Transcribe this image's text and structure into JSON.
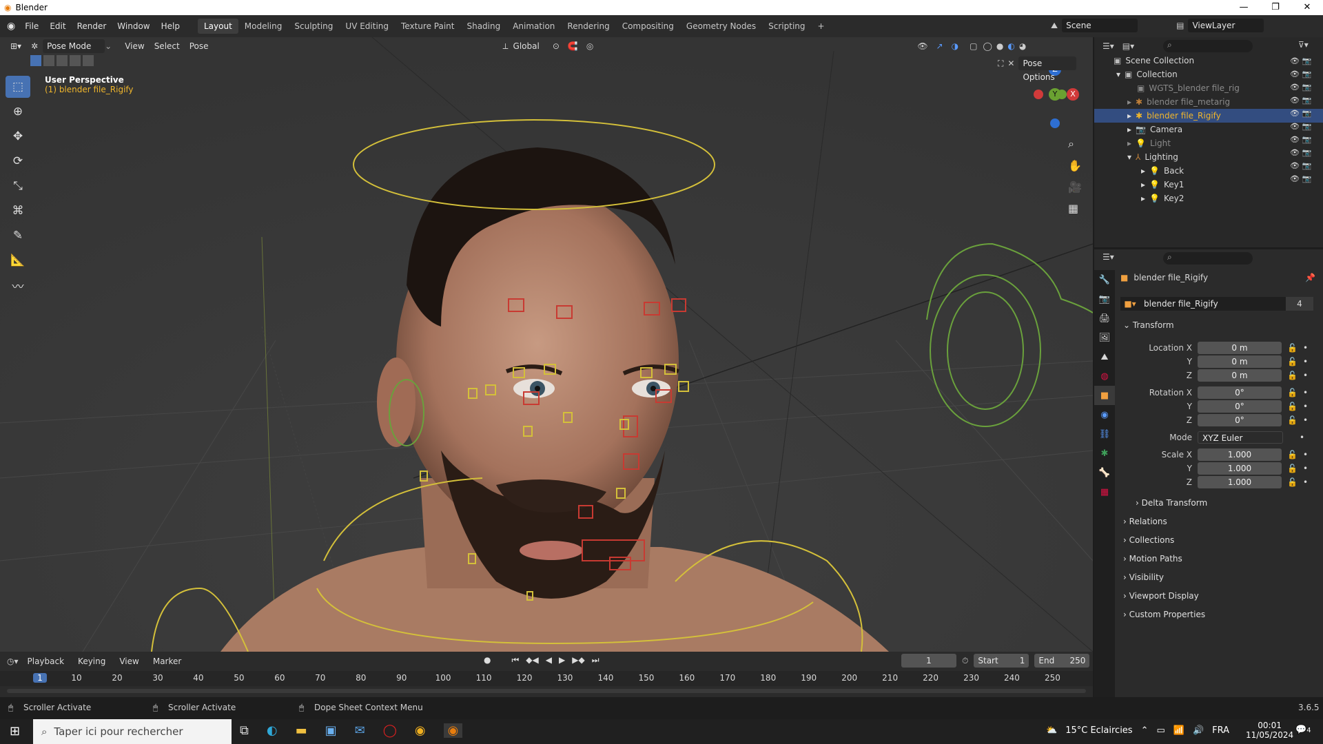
{
  "window": {
    "title": "Blender",
    "controls": [
      "—",
      "❐",
      "✕"
    ]
  },
  "menu": [
    "File",
    "Edit",
    "Render",
    "Window",
    "Help"
  ],
  "workspaces": [
    "Layout",
    "Modeling",
    "Sculpting",
    "UV Editing",
    "Texture Paint",
    "Shading",
    "Animation",
    "Rendering",
    "Compositing",
    "Geometry Nodes",
    "Scripting",
    "+"
  ],
  "active_workspace": "Layout",
  "scene": {
    "label": "Scene",
    "viewlayer": "ViewLayer"
  },
  "viewport_header": {
    "mode": "Pose Mode",
    "menus": [
      "View",
      "Select",
      "Pose"
    ],
    "transform": "Global",
    "pose_options": "Pose Options"
  },
  "viewport": {
    "perspective": "User Perspective",
    "object": "(1) blender file_Rigify"
  },
  "gizmo": {
    "z": "Z",
    "y": "Y",
    "x": "X"
  },
  "outliner": {
    "root": "Scene Collection",
    "rows": [
      {
        "name": "Collection",
        "indent": 1
      },
      {
        "name": "WGTS_blender file_rig",
        "indent": 2,
        "dim": true
      },
      {
        "name": "blender file_metarig",
        "indent": 2,
        "dim": true
      },
      {
        "name": "blender file_Rigify",
        "indent": 2,
        "selected": true
      },
      {
        "name": "Camera",
        "indent": 2
      },
      {
        "name": "Light",
        "indent": 2,
        "dim": true
      },
      {
        "name": "Lighting",
        "indent": 2
      },
      {
        "name": "Back",
        "indent": 3
      },
      {
        "name": "Key1",
        "indent": 3
      },
      {
        "name": "Key2",
        "indent": 3
      }
    ]
  },
  "properties": {
    "object_name": "blender file_Rigify",
    "data_name": "blender file_Rigify",
    "users": "4",
    "transform_label": "Transform",
    "location": {
      "label": "Location X",
      "x": "0 m",
      "y": "0 m",
      "z": "0 m"
    },
    "rotation": {
      "label": "Rotation X",
      "x": "0°",
      "y": "0°",
      "z": "0°"
    },
    "mode_label": "Mode",
    "mode_value": "XYZ Euler",
    "scale": {
      "label": "Scale X",
      "x": "1.000",
      "y": "1.000",
      "z": "1.000"
    },
    "axis_y": "Y",
    "axis_z": "Z",
    "sections": [
      "Delta Transform",
      "Relations",
      "Collections",
      "Motion Paths",
      "Visibility",
      "Viewport Display",
      "Custom Properties"
    ]
  },
  "timeline": {
    "menus": [
      "Playback",
      "Keying",
      "View",
      "Marker"
    ],
    "current_frame": "1",
    "start_label": "Start",
    "start": "1",
    "end_label": "End",
    "end": "250",
    "ticks": [
      "1",
      "10",
      "20",
      "30",
      "40",
      "50",
      "60",
      "70",
      "80",
      "90",
      "100",
      "110",
      "120",
      "130",
      "140",
      "150",
      "160",
      "170",
      "180",
      "190",
      "200",
      "210",
      "220",
      "230",
      "240",
      "250"
    ]
  },
  "status": {
    "left": "Scroller Activate",
    "middle": "Scroller Activate",
    "right": "Dope Sheet Context Menu",
    "version": "3.6.5"
  },
  "taskbar": {
    "search_placeholder": "Taper ici pour rechercher",
    "weather": "15°C  Eclaircies",
    "lang": "FRA",
    "time": "00:01",
    "date": "11/05/2024",
    "notif": "4"
  }
}
